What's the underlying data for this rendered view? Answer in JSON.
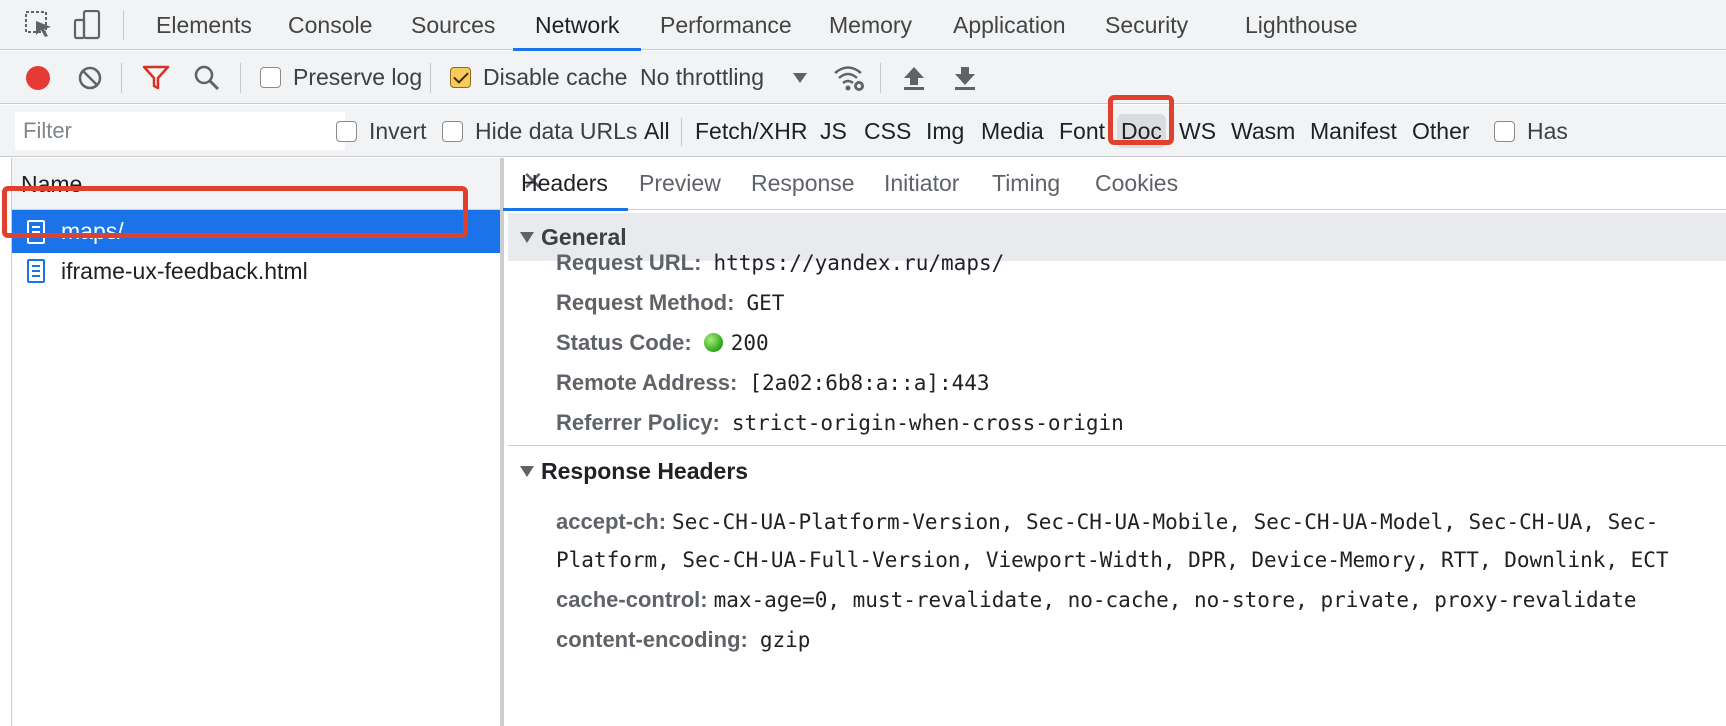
{
  "main_tabs": [
    {
      "label": "Elements"
    },
    {
      "label": "Console"
    },
    {
      "label": "Sources"
    },
    {
      "label": "Network",
      "active": true
    },
    {
      "label": "Performance"
    },
    {
      "label": "Memory"
    },
    {
      "label": "Application"
    },
    {
      "label": "Security"
    },
    {
      "label": "Lighthouse"
    }
  ],
  "toolbar": {
    "preserve_log_label": "Preserve log",
    "preserve_log_checked": false,
    "disable_cache_label": "Disable cache",
    "disable_cache_checked": true,
    "throttling_value": "No throttling"
  },
  "filter_bar": {
    "placeholder": "Filter",
    "invert_label": "Invert",
    "hide_data_urls_label": "Hide data URLs",
    "types": [
      "All",
      "Fetch/XHR",
      "JS",
      "CSS",
      "Img",
      "Media",
      "Font",
      "Doc",
      "WS",
      "Wasm",
      "Manifest",
      "Other"
    ],
    "selected_type": "Doc",
    "has_blocked_label": "Has"
  },
  "requests": {
    "column_header": "Name",
    "items": [
      {
        "name": "maps/",
        "selected": true
      },
      {
        "name": "iframe-ux-feedback.html",
        "selected": false
      }
    ]
  },
  "details": {
    "tabs": [
      "Headers",
      "Preview",
      "Response",
      "Initiator",
      "Timing",
      "Cookies"
    ],
    "active_tab": "Headers",
    "general": {
      "title": "General",
      "request_url_key": "Request URL:",
      "request_url": "https://yandex.ru/maps/",
      "request_method_key": "Request Method:",
      "request_method": "GET",
      "status_code_key": "Status Code:",
      "status_code": "200",
      "remote_address_key": "Remote Address:",
      "remote_address": "[2a02:6b8:a::a]:443",
      "referrer_policy_key": "Referrer Policy:",
      "referrer_policy": "strict-origin-when-cross-origin"
    },
    "response_headers": {
      "title": "Response Headers",
      "accept_ch_key": "accept-ch:",
      "accept_ch_line1": "Sec-CH-UA-Platform-Version, Sec-CH-UA-Mobile, Sec-CH-UA-Model, Sec-CH-UA, Sec-",
      "accept_ch_line2": "Platform, Sec-CH-UA-Full-Version, Viewport-Width, DPR, Device-Memory, RTT, Downlink, ECT",
      "cache_control_key": "cache-control:",
      "cache_control": "max-age=0, must-revalidate, no-cache, no-store, private, proxy-revalidate",
      "content_encoding_key": "content-encoding:",
      "content_encoding": "gzip"
    }
  },
  "colors": {
    "accent": "#1a73e8",
    "highlight": "#e0412f",
    "record": "#e53935",
    "filter_icon": "#d93025"
  },
  "icons": [
    "inspect-icon",
    "device-toggle-icon",
    "record-icon",
    "clear-icon",
    "filter-icon",
    "search-icon",
    "dropdown-arrow-icon",
    "network-conditions-icon",
    "upload-icon",
    "download-icon",
    "close-icon",
    "document-icon",
    "status-green-dot-icon"
  ]
}
